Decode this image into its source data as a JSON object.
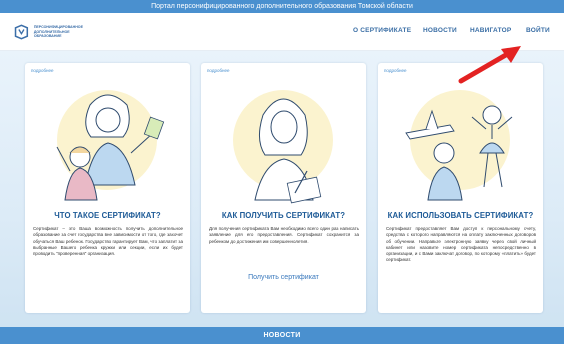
{
  "topbar": {
    "text": "Портал персонифицированного дополнительного образования Томской области"
  },
  "logo": {
    "line1": "Персонифицированное",
    "line2": "дополнительное",
    "line3": "образование"
  },
  "nav": {
    "items": [
      {
        "label": "О СЕРТИФИКАТЕ"
      },
      {
        "label": "НОВОСТИ"
      },
      {
        "label": "НАВИГАТОР"
      },
      {
        "label": "ВОЙТИ"
      }
    ]
  },
  "cards": [
    {
      "more": "подробнее",
      "title": "ЧТО ТАКОЕ СЕРТИФИКАТ?",
      "text": "Сертификат – это Ваша возможность получить дополнительное образование за счет государства вне зависимости от того, где захочет обучаться Ваш ребенок. Государство гарантирует Вам, что заплатит за выбранные Вашего ребенка кружки или секции, если их будет проводить \"проверенная\" организация."
    },
    {
      "more": "подробнее",
      "title": "КАК ПОЛУЧИТЬ СЕРТИФИКАТ?",
      "text": "Для получения сертификата Вам необходимо всего один раз написать заявление для его предоставления. Сертификат сохранится за ребенком до достижения им совершеннолетия.",
      "link": "Получить сертификат"
    },
    {
      "more": "подробнее",
      "title": "КАК ИСПОЛЬЗОВАТЬ СЕРТИФИКАТ?",
      "text": "Сертификат предоставляет Вам доступ к персональному счету, средства с которого направляются на оплату заключенных договоров об обучении. Направьте электронную заявку через свой личный кабинет или назовите номер сертификата непосредственно в организации, и с Вами заключат договор, по которому «платить» будет сертификат."
    }
  ],
  "footer": {
    "label": "НОВОСТИ"
  },
  "colors": {
    "accent": "#4a90cf",
    "title": "#1d5a96",
    "arrow": "#e32222"
  }
}
